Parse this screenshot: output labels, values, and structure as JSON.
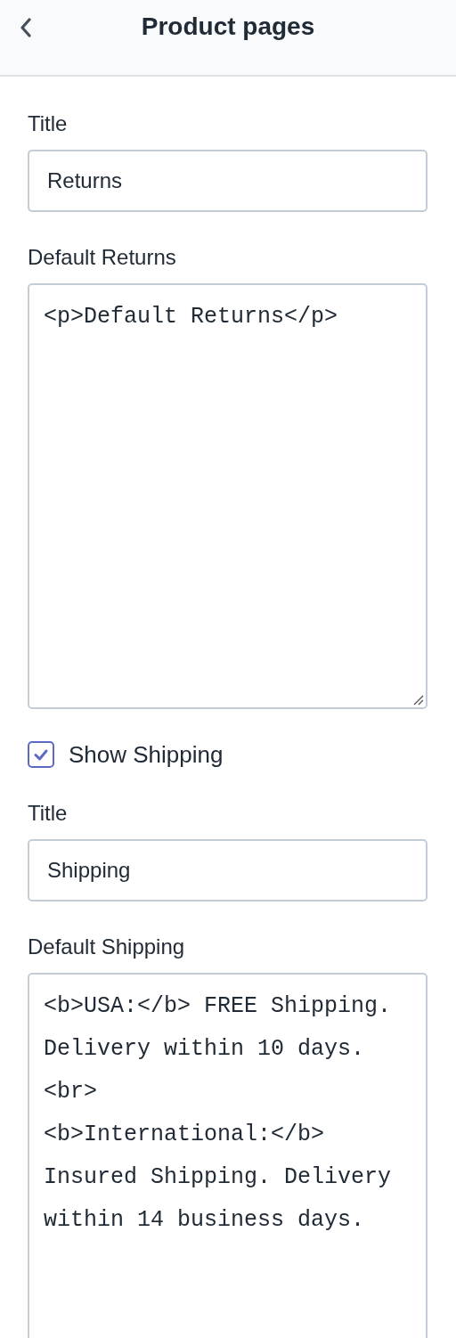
{
  "header": {
    "title": "Product pages"
  },
  "settings": [
    {
      "kind": "text",
      "label": "Title",
      "value": "Returns"
    },
    {
      "kind": "textarea",
      "label": "Default Returns",
      "value": "<p>Default Returns</p>"
    },
    {
      "kind": "checkbox",
      "label": "Show Shipping",
      "checked": true
    },
    {
      "kind": "text",
      "label": "Title",
      "value": "Shipping"
    },
    {
      "kind": "textarea",
      "label": "Default Shipping",
      "value": "<b>USA:</b> FREE Shipping.\nDelivery within 10 days.\n<br>\n<b>International:</b>\nInsured Shipping. Delivery\nwithin 14 business days."
    }
  ]
}
